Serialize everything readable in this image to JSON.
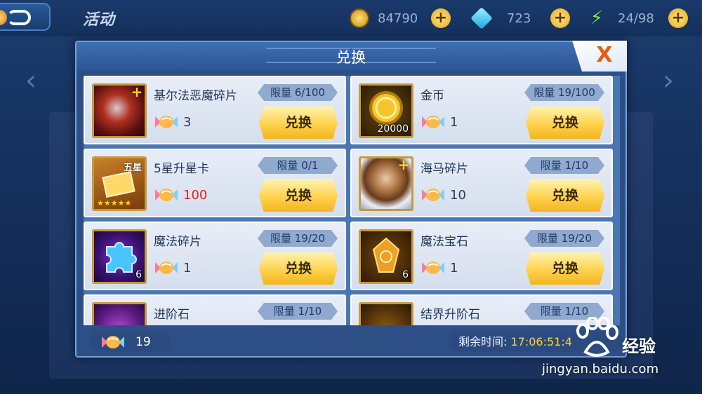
{
  "topbar": {
    "title": "活动",
    "coins": "84790",
    "gems": "723",
    "energy": "24/98"
  },
  "modal": {
    "title": "兑换",
    "close_label": "X",
    "items": [
      {
        "name": "基尔法恶魔碎片",
        "limit": "限量 6/100",
        "cost": "3",
        "button": "兑换"
      },
      {
        "name": "金币",
        "limit": "限量 19/100",
        "cost": "1",
        "button": "兑换",
        "qty": "20000"
      },
      {
        "name": "5星升星卡",
        "limit": "限量 0/1",
        "cost": "100",
        "button": "兑换",
        "card_tag": "五星"
      },
      {
        "name": "海马碎片",
        "limit": "限量 1/10",
        "cost": "10",
        "button": "兑换"
      },
      {
        "name": "魔法碎片",
        "limit": "限量 19/20",
        "cost": "1",
        "button": "兑换",
        "qty": "6"
      },
      {
        "name": "魔法宝石",
        "limit": "限量 19/20",
        "cost": "1",
        "button": "兑换",
        "qty": "6"
      },
      {
        "name": "进阶石",
        "limit": "限量 1/10"
      },
      {
        "name": "结界升阶石",
        "limit": "限量 1/10"
      }
    ],
    "footer": {
      "candy_total": "19",
      "remain_label": "剩余时间:",
      "remain_value": "17:06:51:4"
    }
  },
  "watermark": {
    "brand": "经验",
    "url": "jingyan.baidu.com"
  },
  "colors": {
    "accent": "#ffd24d",
    "cost_insufficient": "#e0221c",
    "modal_bg": "#2d4f86"
  }
}
